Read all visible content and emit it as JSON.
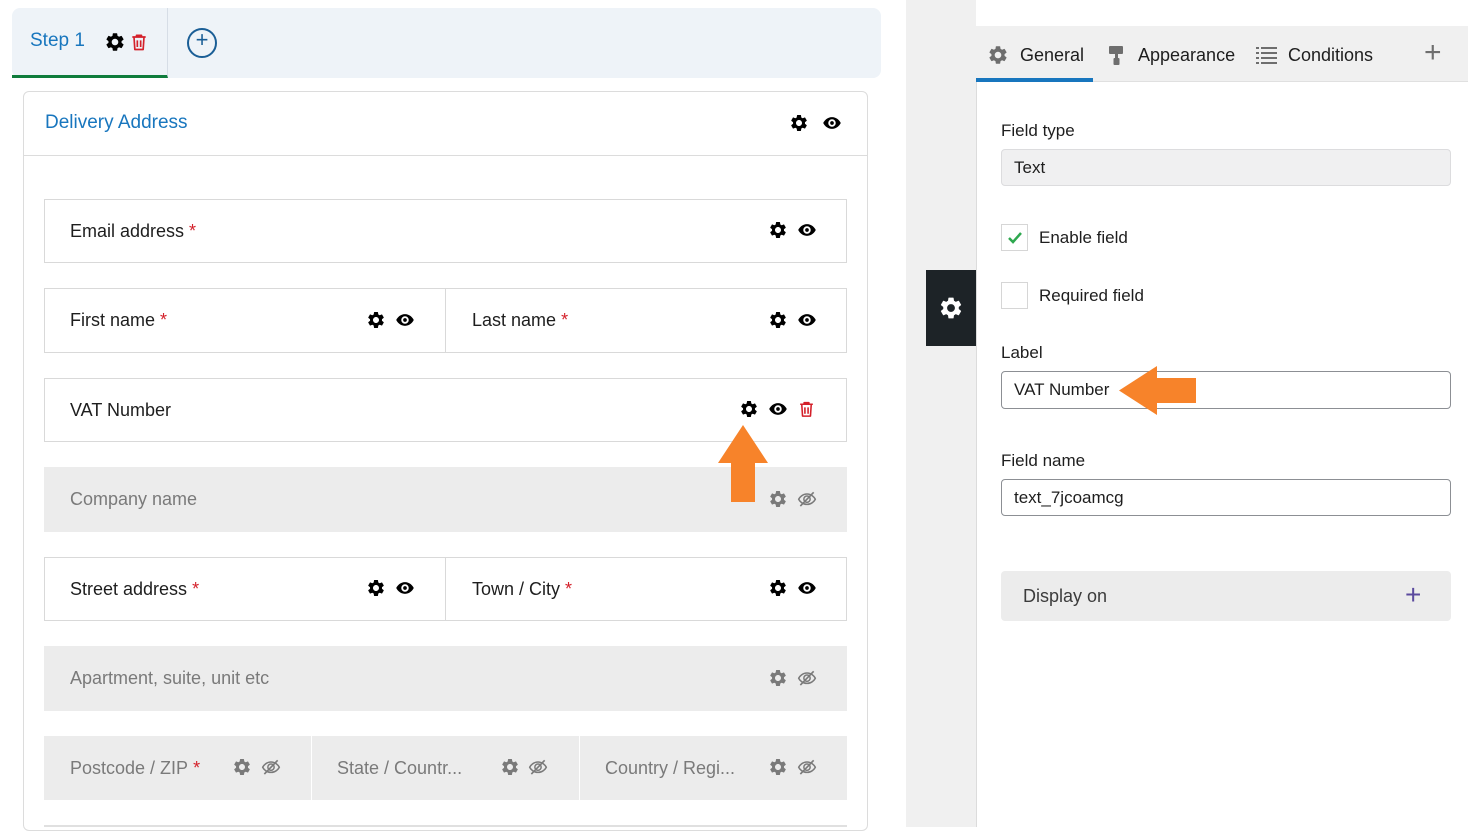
{
  "steps": {
    "active_label": "Step 1",
    "add_symbol": "+"
  },
  "section": {
    "title": "Delivery Address"
  },
  "fields": {
    "email": {
      "label": "Email address",
      "required": "*"
    },
    "first_name": {
      "label": "First name",
      "required": "*"
    },
    "last_name": {
      "label": "Last name",
      "required": "*"
    },
    "vat": {
      "label": "VAT Number"
    },
    "company": {
      "label": "Company name"
    },
    "street": {
      "label": "Street address",
      "required": "*"
    },
    "town": {
      "label": "Town / City",
      "required": "*"
    },
    "apartment": {
      "label": "Apartment, suite, unit etc"
    },
    "postcode": {
      "label": "Postcode / ZIP",
      "required": "*"
    },
    "state": {
      "label": "State / Countr..."
    },
    "country": {
      "label": "Country / Regi..."
    }
  },
  "panel": {
    "tabs": [
      {
        "label": "General",
        "icon": "gear-icon"
      },
      {
        "label": "Appearance",
        "icon": "paint-roller-icon"
      },
      {
        "label": "Conditions",
        "icon": "list-icon"
      }
    ],
    "add_tab_symbol": "+",
    "field_type_label": "Field type",
    "field_type_value": "Text",
    "enable_field_label": "Enable field",
    "enable_field_checked": true,
    "required_field_label": "Required field",
    "required_field_checked": false,
    "label_label": "Label",
    "label_value": "VAT Number",
    "field_name_label": "Field name",
    "field_name_value": "text_7jcoamcg",
    "display_on_label": "Display on",
    "display_on_symbol": "+"
  },
  "colors": {
    "accent_blue": "#1876be",
    "active_green": "#0f7c3c",
    "required_red": "#d4202a",
    "delete_red": "#d4202a",
    "annotation_orange": "#f7832a",
    "handle_dark": "#1d2327",
    "plus_purple": "#5b4a9e"
  }
}
